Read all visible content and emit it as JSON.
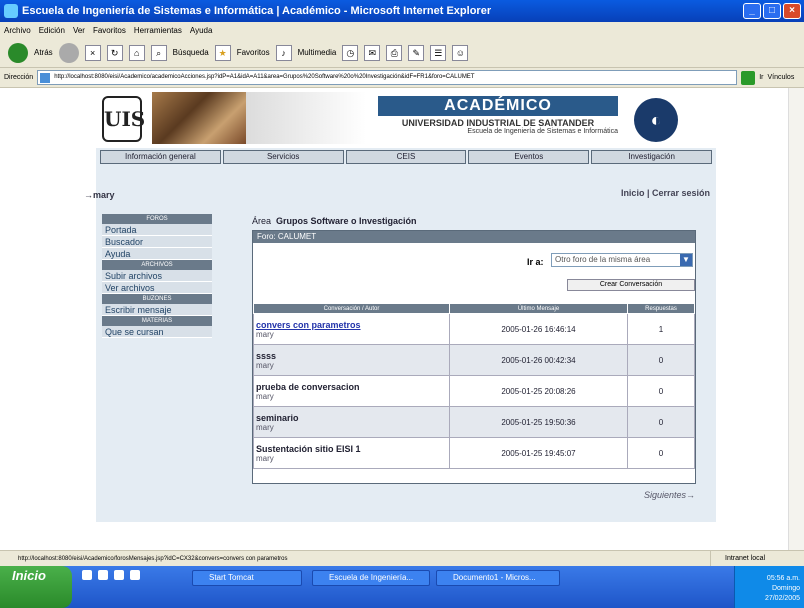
{
  "window": {
    "title": "Escuela de Ingeniería de Sistemas e Informática | Académico - Microsoft Internet Explorer"
  },
  "menu": [
    "Archivo",
    "Edición",
    "Ver",
    "Favoritos",
    "Herramientas",
    "Ayuda"
  ],
  "toolbar": {
    "back": "Atrás",
    "search": "Búsqueda",
    "favorites": "Favoritos",
    "multimedia": "Multimedia"
  },
  "address": {
    "label": "Dirección",
    "url": "http://localhost:8080/eisi/Academico/academicoAcciones.jsp?idP=A1&idA=A11&area=Grupos%20Software%20o%20Investigación&idF=FR1&foro=CALUMET",
    "go": "Ir",
    "links": "Vínculos"
  },
  "header": {
    "logo_left": "UIS",
    "title": "ACADÉMICO",
    "subtitle": "Escuela de Ingeniería de Sistemas e Informática",
    "university": "UNIVERSIDAD INDUSTRIAL DE SANTANDER"
  },
  "nav": [
    "Información general",
    "Servicios",
    "CEIS",
    "Eventos",
    "Investigación"
  ],
  "user": {
    "name": "mary",
    "links": "Inicio | Cerrar sesión"
  },
  "sidebar": {
    "sections": [
      {
        "title": "FOROS",
        "items": [
          "Portada",
          "Buscador",
          "Ayuda"
        ]
      },
      {
        "title": "ARCHIVOS",
        "items": [
          "Subir archivos",
          "Ver archivos"
        ]
      },
      {
        "title": "BUZONES",
        "items": [
          "Escribir mensaje"
        ]
      },
      {
        "title": "MATERIAS",
        "items": [
          "Que se cursan"
        ]
      }
    ]
  },
  "area": {
    "label": "Área",
    "value": "Grupos Software o Investigación"
  },
  "forum": {
    "header": "Foro: CALUMET",
    "ir_label": "Ir a:",
    "select_value": "Otro foro de la misma área",
    "create_button": "Crear Conversación",
    "columns": [
      "Conversación / Autor",
      "Último Mensaje",
      "Respuestas"
    ],
    "rows": [
      {
        "title": "convers con parametros",
        "author": "mary",
        "last": "2005-01-26 16:46:14",
        "replies": "1"
      },
      {
        "title": "ssss",
        "author": "mary",
        "last": "2005-01-26 00:42:34",
        "replies": "0"
      },
      {
        "title": "prueba de conversacion",
        "author": "mary",
        "last": "2005-01-25 20:08:26",
        "replies": "0"
      },
      {
        "title": "seminario",
        "author": "mary",
        "last": "2005-01-25 19:50:36",
        "replies": "0"
      },
      {
        "title": "Sustentación sitio EISI 1",
        "author": "mary",
        "last": "2005-01-25 19:45:07",
        "replies": "0"
      }
    ],
    "next": "Siguientes"
  },
  "status": {
    "url": "http://localhost:8080/eisi/Academico/forosMensajes.jsp?idC=CX32&convers=convers con parametros",
    "zone": "Intranet local"
  },
  "taskbar": {
    "start": "Inicio",
    "tasks": [
      "Start Tomcat",
      "Escuela de Ingeniería...",
      "Documento1 - Micros..."
    ],
    "time": "05:56 a.m.",
    "day": "Domingo",
    "date": "27/02/2005"
  }
}
